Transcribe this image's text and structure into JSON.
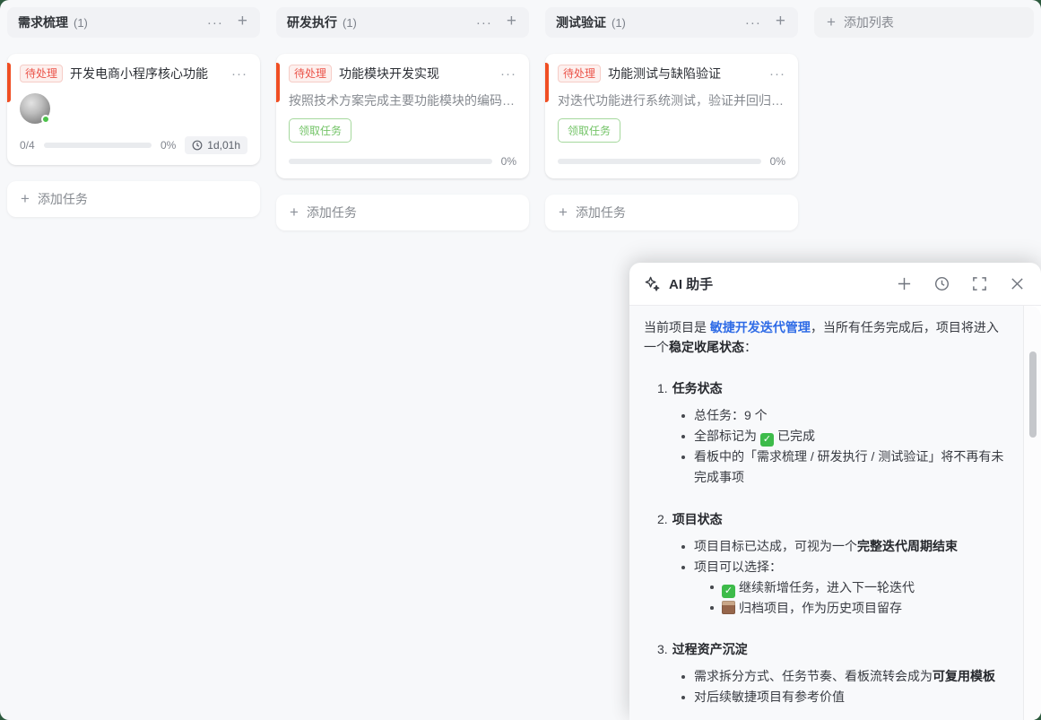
{
  "colors": {
    "desktop_background": "#2d5a3e",
    "board_background": "#f7f8fa",
    "card_accent": "#f04e23",
    "badge_text": "#eb544a",
    "badge_background": "#fdf0ee",
    "claim_green": "#74c468",
    "link_blue": "#2e6be6",
    "progress_track": "#e9ebee",
    "online_dot_green": "#4cc24a"
  },
  "icons": {
    "more": "···",
    "plus": "+",
    "check": "✓"
  },
  "board": {
    "columns": [
      {
        "title": "需求梳理",
        "count": "(1)",
        "add_task": "添加任务",
        "card": {
          "badge": "待处理",
          "title": "开发电商小程序核心功能",
          "done": "0/4",
          "percent": "0%",
          "duration": "1d,01h"
        }
      },
      {
        "title": "研发执行",
        "count": "(1)",
        "add_task": "添加任务",
        "card": {
          "badge": "待处理",
          "title": "功能模块开发实现",
          "desc": "按照技术方案完成主要功能模块的编码…",
          "claim": "领取任务",
          "percent": "0%"
        }
      },
      {
        "title": "测试验证",
        "count": "(1)",
        "add_task": "添加任务",
        "card": {
          "badge": "待处理",
          "title": "功能测试与缺陷验证",
          "desc": "对迭代功能进行系统测试，验证并回归…",
          "claim": "领取任务",
          "percent": "0%"
        }
      }
    ],
    "add_list": "添加列表"
  },
  "assistant": {
    "title": "AI 助手",
    "intro": {
      "pre": "当前项目是 ",
      "link": "敏捷开发迭代管理",
      "mid": "，当所有任务完成后，项目将进入一个",
      "bold": "稳定收尾状态",
      "colon": "："
    },
    "s1": {
      "num": "1.",
      "heading": "任务状态",
      "b1": "总任务：9 个",
      "b2_pre": "全部标记为",
      "b2_post": "已完成",
      "b3": "看板中的「需求梳理 / 研发执行 / 测试验证」将不再有未完成事项"
    },
    "s2": {
      "num": "2.",
      "heading": "项目状态",
      "b1_pre": "项目目标已达成，可视为一个",
      "b1_bold": "完整迭代周期结束",
      "b2": "项目可以选择：",
      "sub1": "继续新增任务，进入下一轮迭代",
      "sub2": "归档项目，作为历史项目留存"
    },
    "s3": {
      "num": "3.",
      "heading": "过程资产沉淀",
      "b1_pre": "需求拆分方式、任务节奏、看板流转会成为",
      "b1_bold": "可复用模板",
      "b2": "对后续敏捷项目有参考价值"
    }
  }
}
